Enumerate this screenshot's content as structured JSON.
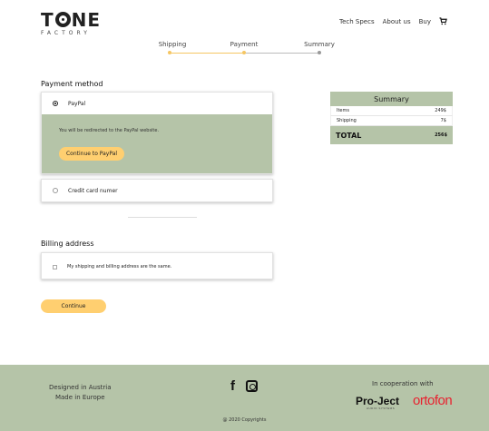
{
  "header": {
    "logo_main_left": "T",
    "logo_main_right": "NE",
    "logo_sub": "FACTORY",
    "nav": {
      "tech_specs": "Tech Specs",
      "about": "About us",
      "buy": "Buy",
      "cart_icon": "cart-icon"
    }
  },
  "steps": [
    {
      "label": "Shipping",
      "state": "done"
    },
    {
      "label": "Payment",
      "state": "active"
    },
    {
      "label": "Summary",
      "state": "pending"
    }
  ],
  "payment": {
    "title": "Payment method",
    "paypal_label": "PayPal",
    "paypal_selected": true,
    "redirect_text": "You will be redirected to the PayPal website.",
    "continue_paypal": "Continue to PayPal",
    "credit_label": "Credit card numer"
  },
  "billing": {
    "title": "Billing address",
    "same_address_label": "My shipping and billing address are the same.",
    "continue": "Continue"
  },
  "summary": {
    "title": "Summary",
    "items_label": "Items",
    "items_value": "249$",
    "shipping_label": "Shipping",
    "shipping_value": "7$",
    "total_label": "TOTAL",
    "total_value": "256$"
  },
  "footer": {
    "line1": "Designed in Austria",
    "line2": "Made in Europe",
    "social": [
      "facebook-icon",
      "instagram-icon"
    ],
    "coop": "In cooperation with",
    "brand1": "Pro-Ject",
    "brand1_tag": "AUDIO SYSTEMS",
    "brand2": "ortofon",
    "copyright": "@ 2020 Copyrights"
  },
  "colors": {
    "accent_green": "#b5c4a8",
    "button_yellow": "#ffcf70",
    "step_done": "#f5c663",
    "step_pending": "#999999",
    "ortofon_red": "#e8212f"
  }
}
